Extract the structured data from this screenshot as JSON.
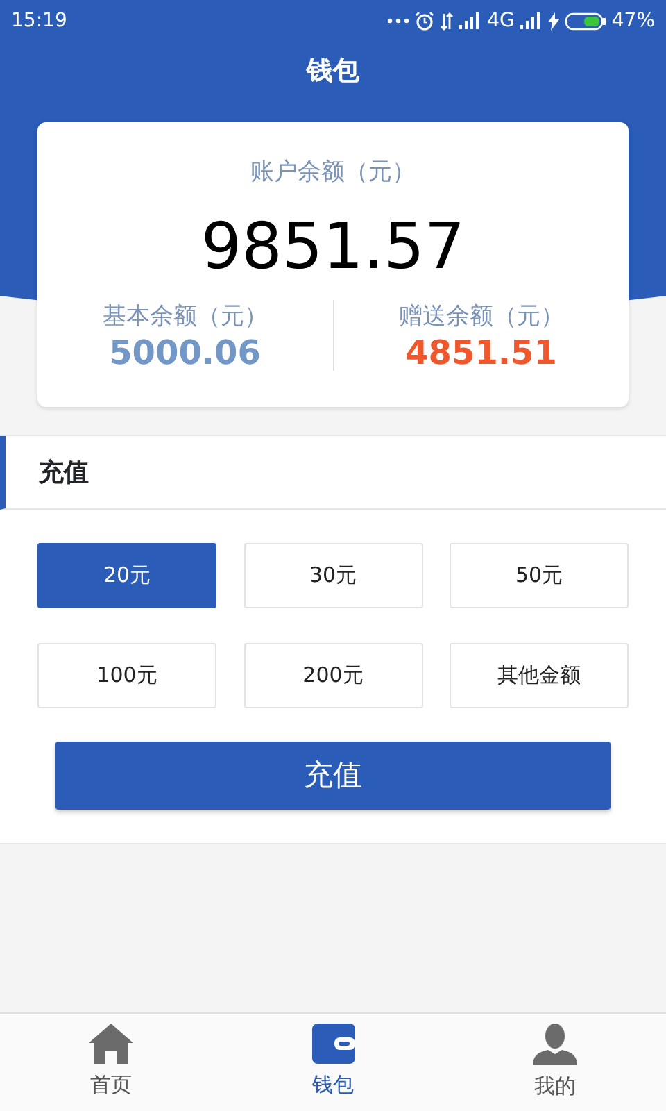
{
  "status_bar": {
    "time": "15:19",
    "network": "4G",
    "battery": "47%"
  },
  "title": "钱包",
  "balance": {
    "label": "账户余额（元）",
    "amount": "9851.57",
    "parts": [
      {
        "label": "基本余额（元）",
        "amount": "5000.06",
        "color": "#7397c6"
      },
      {
        "label": "赠送余额（元）",
        "amount": "4851.51",
        "color": "#f0572c"
      }
    ]
  },
  "recharge": {
    "title": "充值",
    "options": [
      {
        "label": "20元",
        "selected": true
      },
      {
        "label": "30元",
        "selected": false
      },
      {
        "label": "50元",
        "selected": false
      },
      {
        "label": "100元",
        "selected": false
      },
      {
        "label": "200元",
        "selected": false
      },
      {
        "label": "其他金额",
        "selected": false
      }
    ],
    "button": "充值"
  },
  "tabs": [
    {
      "label": "首页",
      "kind": "home",
      "selected": false
    },
    {
      "label": "钱包",
      "kind": "wallet",
      "selected": true
    },
    {
      "label": "我的",
      "kind": "profile",
      "selected": false
    }
  ]
}
